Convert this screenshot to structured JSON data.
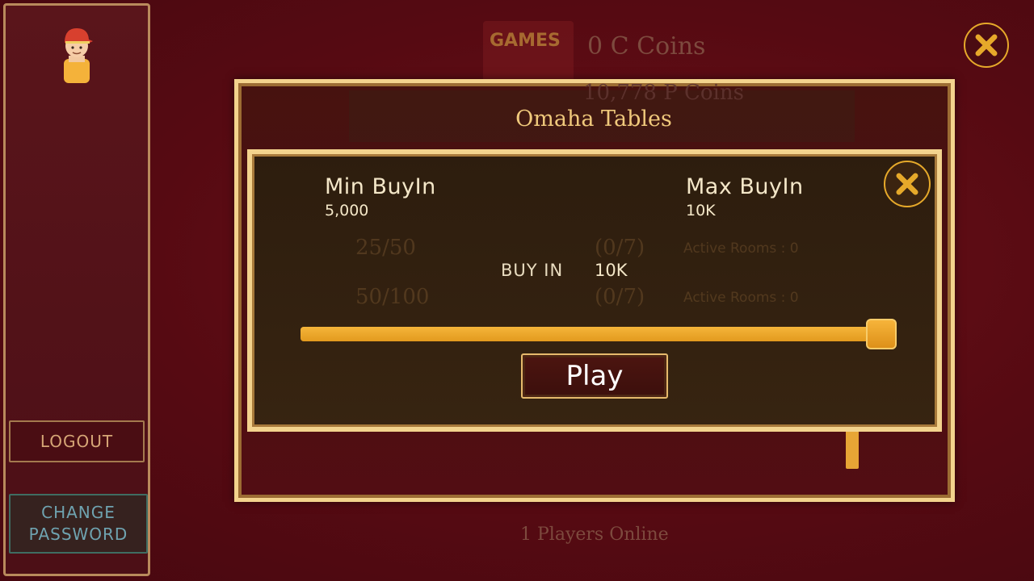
{
  "header": {
    "logo_text": "GAMES",
    "c_coins": "0 C Coins",
    "p_coins": "10,778 P Coins"
  },
  "sidebar": {
    "logout_label": "LOGOUT",
    "change_password_line1": "CHANGE",
    "change_password_line2": "PASSWORD"
  },
  "dialog": {
    "title": "Omaha Tables",
    "min_buyin_label": "Min BuyIn",
    "min_buyin_value": "5,000",
    "max_buyin_label": "Max BuyIn",
    "max_buyin_value": "10K",
    "buyin_label": "BUY IN",
    "buyin_value": "10K",
    "slider_level": 1.0,
    "play_label": "Play"
  },
  "background_tables": [
    {
      "stake": "25/50",
      "seats": "(0/7)",
      "rooms": "Active Rooms : 0"
    },
    {
      "stake": "50/100",
      "seats": "(0/7)",
      "rooms": "Active Rooms : 0"
    }
  ],
  "footer": {
    "players_online": "1 Players Online"
  },
  "colors": {
    "background": "#5a0a12",
    "gold_border": "#f3d38d",
    "accent_orange": "#e7a535",
    "close_ring": "#e6a92a"
  },
  "icons": {
    "avatar": "avatar-icon",
    "close": "close-icon"
  }
}
